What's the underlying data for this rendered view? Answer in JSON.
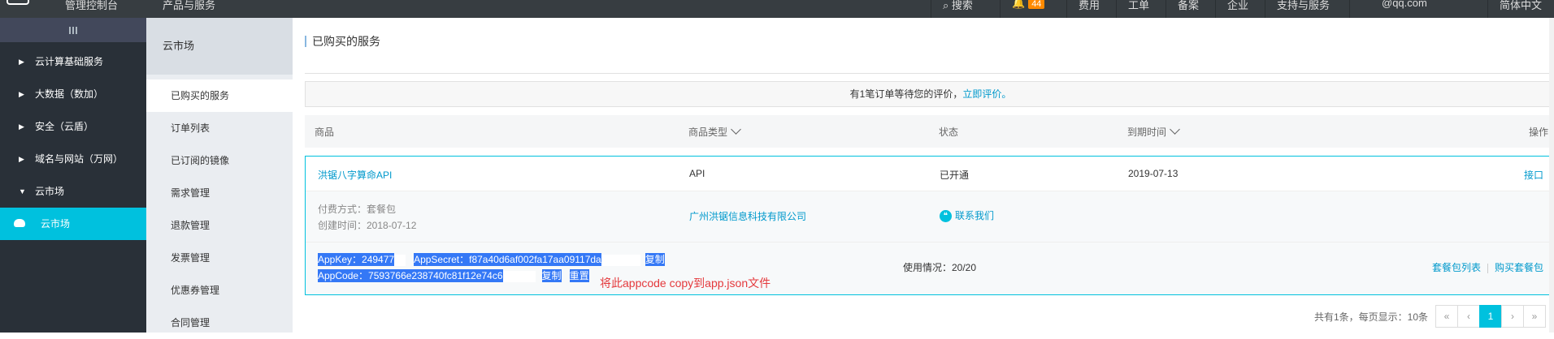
{
  "topbar": {
    "console": "管理控制台",
    "products": "产品与服务",
    "search": "搜索",
    "badge_count": "44",
    "items": [
      "费用",
      "工单",
      "备案",
      "企业",
      "支持与服务"
    ],
    "account": "@qq.com",
    "language": "简体中文"
  },
  "sidebar": {
    "items": [
      {
        "label": "云计算基础服务"
      },
      {
        "label": "大数据（数加）"
      },
      {
        "label": "安全（云盾）"
      },
      {
        "label": "域名与网站（万网）"
      },
      {
        "label": "云市场"
      }
    ],
    "active": "云市场"
  },
  "subnav": {
    "title": "云市场",
    "items": [
      "已购买的服务",
      "订单列表",
      "已订阅的镜像",
      "需求管理",
      "退款管理",
      "发票管理",
      "优惠券管理",
      "合同管理"
    ]
  },
  "main": {
    "title": "已购买的服务",
    "notice_text": "有1笔订单等待您的评价，",
    "notice_link": "立即评价。",
    "columns": {
      "product": "商品",
      "type": "商品类型",
      "status": "状态",
      "expire": "到期时间",
      "action": "操作"
    },
    "order": {
      "name": "洪锯八字算命API",
      "type": "API",
      "status": "已开通",
      "expire": "2019-07-13",
      "action": "接口",
      "pay_method": "付费方式：套餐包",
      "created": "创建时间：2018-07-12",
      "vendor": "广州洪锯信息科技有限公司",
      "contact": "联系我们",
      "appkey_label": "AppKey：249477",
      "appsecret_label": "AppSecret：f87a40d6af002fa17aa09117da",
      "copy1": "复制",
      "appcode_label": "AppCode：7593766e238740fc81f12e74c6",
      "copy2": "复制",
      "reset": "重置",
      "annotation": "将此appcode copy到app.json文件",
      "usage": "使用情况：20/20",
      "package_list": "套餐包列表",
      "buy_package": "购买套餐包"
    },
    "pager": {
      "info": "共有1条，每页显示：10条",
      "current": "1"
    }
  }
}
